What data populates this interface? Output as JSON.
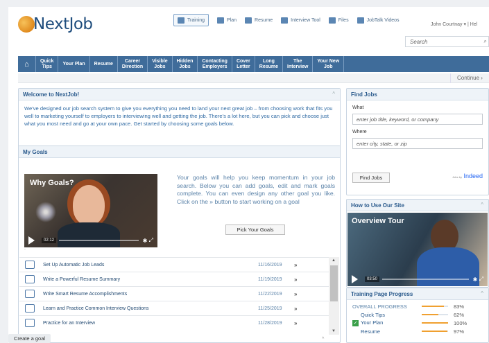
{
  "logo": {
    "text": "NextJob"
  },
  "topnav": [
    {
      "label": "Training",
      "icon": "training-icon"
    },
    {
      "label": "Plan",
      "icon": "plan-icon"
    },
    {
      "label": "Resume",
      "icon": "resume-icon"
    },
    {
      "label": "Interview Tool",
      "icon": "interview-icon"
    },
    {
      "label": "Files",
      "icon": "files-icon"
    },
    {
      "label": "JobTalk Videos",
      "icon": "video-icon"
    }
  ],
  "user": {
    "name": "John Courtnay",
    "caret": "▾",
    "separator": "|",
    "help": "Hel"
  },
  "search": {
    "placeholder": "Search",
    "icon": "⌕"
  },
  "bluenav": [
    {
      "label": "⌂"
    },
    {
      "label": "Quick\nTips"
    },
    {
      "label": "Your Plan"
    },
    {
      "label": "Resume"
    },
    {
      "label": "Career\nDirection"
    },
    {
      "label": "Visible\nJobs"
    },
    {
      "label": "Hidden\nJobs"
    },
    {
      "label": "Contacting\nEmployers"
    },
    {
      "label": "Cover\nLetter"
    },
    {
      "label": "Long\nResume"
    },
    {
      "label": "The\nInterview"
    },
    {
      "label": "Your New\nJob"
    }
  ],
  "continue": {
    "label": "Continue ›"
  },
  "welcome": {
    "title": "Welcome to NextJob!",
    "caret": "^",
    "body": "We've designed our job search system to give you everything you need to land your next great job – from choosing work that fits you well to marketing yourself to employers to interviewing well and getting the job. There's a lot here, but you can pick and choose just what you most need and go at your own pace. Get started by choosing some goals below."
  },
  "goals": {
    "title": "My Goals",
    "video_title": "Why Goals?",
    "video_time": "02:12",
    "description": "Your goals will help you keep momentum in your job search. Below you can add goals, edit and mark goals complete. You can even design any other goal you like. Click on the » button to start working on a goal",
    "pick_button": "Pick Your Goals",
    "dot": "·",
    "items": [
      {
        "label": "Set Up Automatic Job Leads",
        "date": "11/16/2019",
        "icon": "lead-icon"
      },
      {
        "label": "Write a Powerful Resume Summary",
        "date": "11/19/2019",
        "icon": "write-icon"
      },
      {
        "label": "Write Smart Resume Accomplishments",
        "date": "11/22/2019",
        "icon": "document-icon"
      },
      {
        "label": "Learn and Practice Common Interview Questions",
        "date": "11/25/2019",
        "icon": "people-icon"
      },
      {
        "label": "Practice for an Interview",
        "date": "11/28/2019",
        "icon": "people-icon"
      }
    ],
    "arrow": "»",
    "create_button": "Create a goal"
  },
  "findjobs": {
    "title": "Find Jobs",
    "caret": "",
    "what_label": "What",
    "what_placeholder": "enter job title, keyword, or company",
    "where_label": "Where",
    "where_placeholder": "enter city, state, or zip",
    "button": "Find Jobs",
    "powered": "Jobs by",
    "brand": "Indeed"
  },
  "howto": {
    "title": "How to Use Our Site",
    "caret": "^",
    "video_title": "Overview Tour",
    "video_time": "03:50"
  },
  "progress": {
    "title": "Training Page Progress",
    "caret": "^",
    "rows": [
      {
        "label": "OVERALL PROGRESS",
        "value": "83%",
        "pct": 0.83,
        "checked": false
      },
      {
        "label": "Quick Tips",
        "value": "62%",
        "pct": 0.62,
        "checked": false
      },
      {
        "label": "Your Plan",
        "value": "100%",
        "pct": 1.0,
        "checked": true
      },
      {
        "label": "Resume",
        "value": "97%",
        "pct": 0.97,
        "checked": false
      }
    ]
  },
  "colors": {
    "nav_blue": "#3f6c9a",
    "link_blue": "#2f6aa3",
    "accent_orange": "#f0a030"
  }
}
